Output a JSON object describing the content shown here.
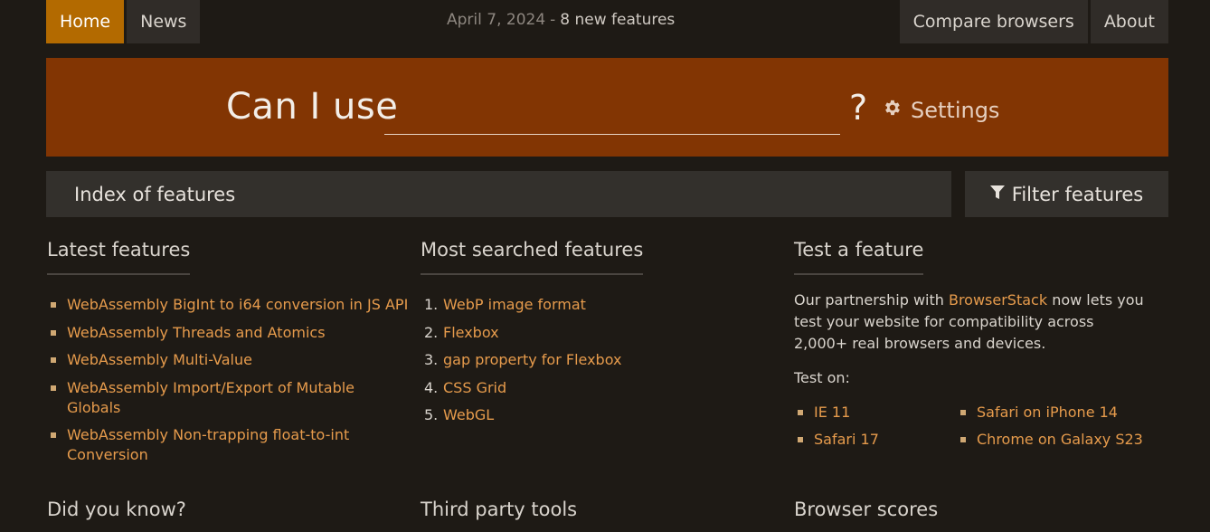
{
  "nav": {
    "home": "Home",
    "news": "News",
    "date": "April 7, 2024",
    "separator": "-",
    "new_features": "8 new features",
    "compare": "Compare browsers",
    "about": "About"
  },
  "banner": {
    "title": "Can I use",
    "input_value": "",
    "question": "?",
    "settings": "Settings"
  },
  "index": {
    "title": "Index of features",
    "filter": "Filter features"
  },
  "latest": {
    "heading": "Latest features",
    "items": [
      "WebAssembly BigInt to i64 conversion in JS API",
      "WebAssembly Threads and Atomics",
      "WebAssembly Multi-Value",
      "WebAssembly Import/Export of Mutable Globals",
      "WebAssembly Non-trapping float-to-int Conversion"
    ]
  },
  "searched": {
    "heading": "Most searched features",
    "items": [
      {
        "num": "1.",
        "label": "WebP image format"
      },
      {
        "num": "2.",
        "label": "Flexbox"
      },
      {
        "num": "3.",
        "label": "gap property for Flexbox"
      },
      {
        "num": "4.",
        "label": "CSS Grid"
      },
      {
        "num": "5.",
        "label": "WebGL"
      }
    ]
  },
  "test": {
    "heading": "Test a feature",
    "para_before": "Our partnership with ",
    "partner": "BrowserStack",
    "para_after": " now lets you test your website for compatibility across 2,000+ real browsers and devices.",
    "test_on": "Test on:",
    "browsers": [
      "IE 11",
      "Safari on iPhone 14",
      "Safari 17",
      "Chrome on Galaxy S23"
    ]
  },
  "bottom": {
    "did_you_know": "Did you know?",
    "third_party": "Third party tools",
    "scores": "Browser scores"
  },
  "colors": {
    "accent": "#b36a00",
    "banner": "#823503",
    "link": "#e69b4c"
  }
}
